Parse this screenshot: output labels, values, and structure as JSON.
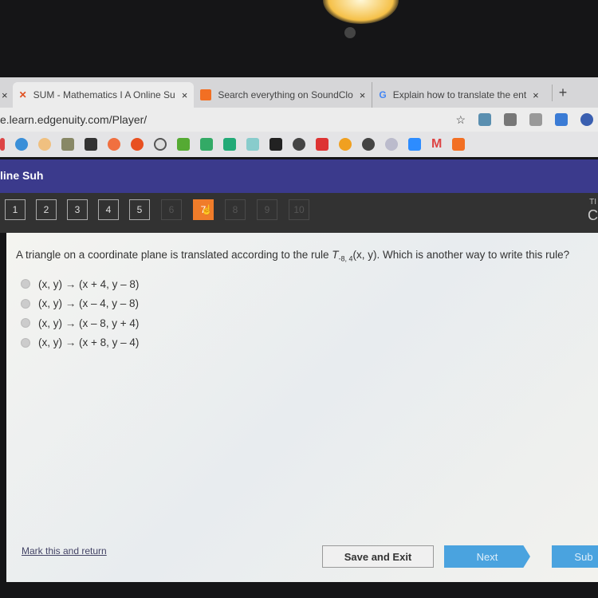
{
  "browser": {
    "tabs": [
      {
        "label": "SUM - Mathematics I A Online Su",
        "icon": "edgenuity-icon",
        "active": true
      },
      {
        "label": "Search everything on SoundClo",
        "icon": "soundcloud-icon",
        "active": false
      },
      {
        "label": "Explain how to translate the ent",
        "icon": "google-icon",
        "active": false
      }
    ],
    "new_tab": "+",
    "close": "×",
    "url": "e.learn.edgenuity.com/Player/"
  },
  "header": {
    "user": "line Suh"
  },
  "nav": {
    "questions": [
      "1",
      "2",
      "3",
      "4",
      "5",
      "6",
      "7",
      "8",
      "9",
      "10"
    ],
    "current": "7",
    "timer_label": "TI",
    "timer_value": "C"
  },
  "question": {
    "prefix": "A triangle on a coordinate plane is translated according to the rule ",
    "rule": "T",
    "rule_sub": "-8, 4",
    "rule_args": "(x, y)",
    "suffix": ". Which is another way to write this rule?",
    "options": [
      "(x, y) → (x + 4, y – 8)",
      "(x, y) → (x – 4, y – 8)",
      "(x, y) → (x – 8, y + 4)",
      "(x, y) → (x + 8, y – 4)"
    ]
  },
  "footer": {
    "mark": "Mark this and return",
    "save": "Save and Exit",
    "next": "Next",
    "submit": "Sub"
  },
  "colors": {
    "header": "#3b3a8c",
    "current_question": "#f07c2a",
    "next": "#4aa3df"
  }
}
